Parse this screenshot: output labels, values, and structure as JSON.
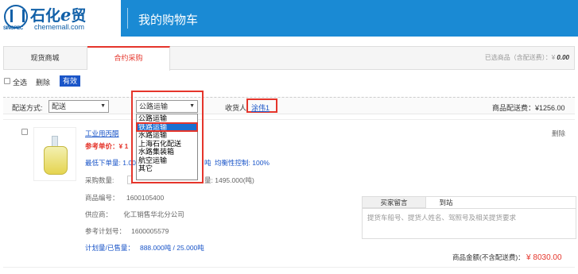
{
  "header": {
    "logo_title": "石化",
    "logo_e": "e",
    "logo_tail": "贸",
    "logo_sub": "SINOPEC",
    "logo_url": "chememall.com",
    "page_title": "我的购物车",
    "bg_color": "#1a8ad4"
  },
  "tabs": [
    {
      "label": "现货商城",
      "active": false
    },
    {
      "label": "合约采购",
      "active": true
    }
  ],
  "tab_summary": {
    "label": "已选商品（含配送费）：¥",
    "value": "0.00"
  },
  "toolbar": {
    "select_all": "全选",
    "delete": "删除",
    "badge": "有效"
  },
  "ship_row": {
    "method_label": "配送方式:",
    "method_value": "配送",
    "transport_value": "公路运输",
    "receiver_label": "收货人:",
    "receiver_value": "涂伟1",
    "fee_label": "商品配送费：¥1256.00"
  },
  "dropdown": {
    "options": [
      "公路运输",
      "铁路运输",
      "水路运输",
      "上海石化配送",
      "水路集装箱",
      "航空运输",
      "其它"
    ],
    "selected_index": 1
  },
  "item": {
    "name": "工业用丙酮",
    "ref_price_label": "参考单价：",
    "ref_price_value": "¥ 1",
    "delete": "删除",
    "min_order_label": "最低下单量:",
    "min_order_value": "1.00",
    "min_order_tail": "吨",
    "balance_label": "均衡性控制:",
    "balance_value": "100%",
    "purchase_qty_label": "采购数量:",
    "purchase_qty_tail": "量:",
    "purchase_qty_value": "1495.000(吨)",
    "code_label": "商品编号：",
    "code_value": "1600105400",
    "supplier_label": "供应商：",
    "supplier_value": "化工销售华北分公司",
    "plan_label": "参考计划号：",
    "plan_value": "1600005579",
    "plan_qty_label": "计划量/已售量：",
    "plan_qty_value": "888.000吨 / 25.000吨",
    "amount_label": "商品金额(不含配送费)：",
    "amount_value": "¥ 8030.00"
  },
  "message": {
    "tab_active": "买家留言",
    "tab_other": "到站",
    "placeholder": "提货车船号、提货人姓名、驾照号及相关提货要求"
  }
}
